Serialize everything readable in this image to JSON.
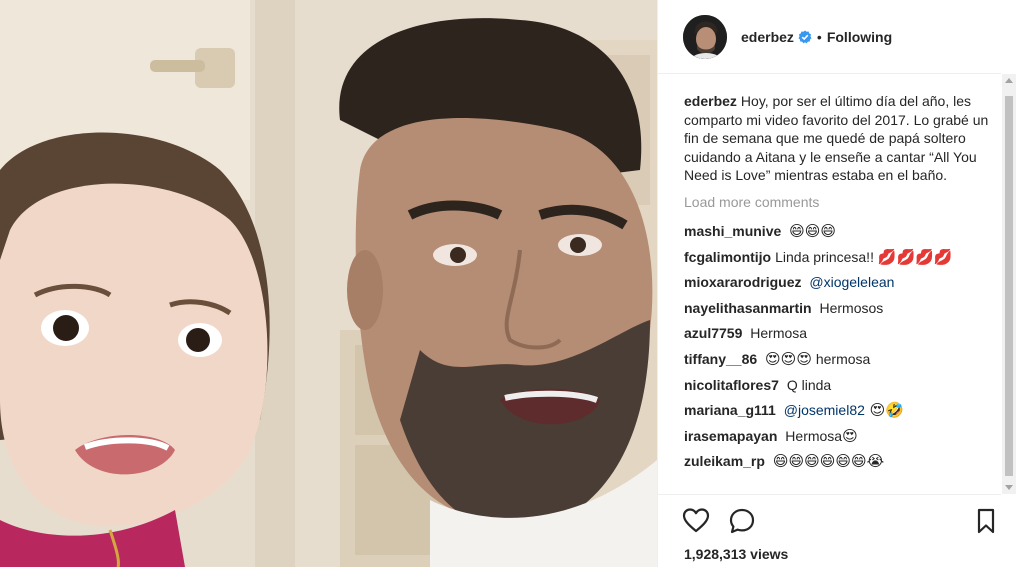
{
  "post": {
    "username": "ederbez",
    "follow_dot": "•",
    "follow_status": "Following",
    "caption_user": "ederbez",
    "caption_text": "Hoy, por ser el último día del año, les comparto mi video favorito del 2017. Lo grabé un fin de semana que me quedé de papá soltero cuidando a Aitana y le enseñe a cantar “All You Need is Love” mientras estaba en el baño.",
    "load_more": "Load more comments",
    "views": "1,928,313 views"
  },
  "comments": [
    {
      "user": "mashi_munive",
      "text": "",
      "emoji": "😄😄😄"
    },
    {
      "user": "fcgalimontijo",
      "text": "Linda princesa!! ",
      "emoji": "💋💋💋💋"
    },
    {
      "user": "mioxararodriguez",
      "text": "",
      "mention": "@xiogelelean"
    },
    {
      "user": "nayelithasanmartin",
      "text": "Hermosos"
    },
    {
      "user": "azul7759",
      "text": "Hermosa"
    },
    {
      "user": "tiffany__86",
      "emoji": "😍😍😍",
      "text": " hermosa"
    },
    {
      "user": "nicolitaflores7",
      "text": "Q linda"
    },
    {
      "user": "mariana_g111",
      "mention": "@josemiel82",
      "emoji": " 😍🤣"
    },
    {
      "user": "irasemapayan",
      "text": "Hermosa",
      "emoji": "😍"
    },
    {
      "user": "zuleikam_rp",
      "emoji": "😄😄😄😄😄😄😭"
    }
  ],
  "icons": {
    "like": "heart-icon",
    "comment": "comment-icon",
    "save": "bookmark-icon",
    "verified": "verified-badge-icon"
  },
  "colors": {
    "verified": "#3897f0",
    "border": "#efefef",
    "muted": "#999999",
    "mention": "#003569"
  }
}
